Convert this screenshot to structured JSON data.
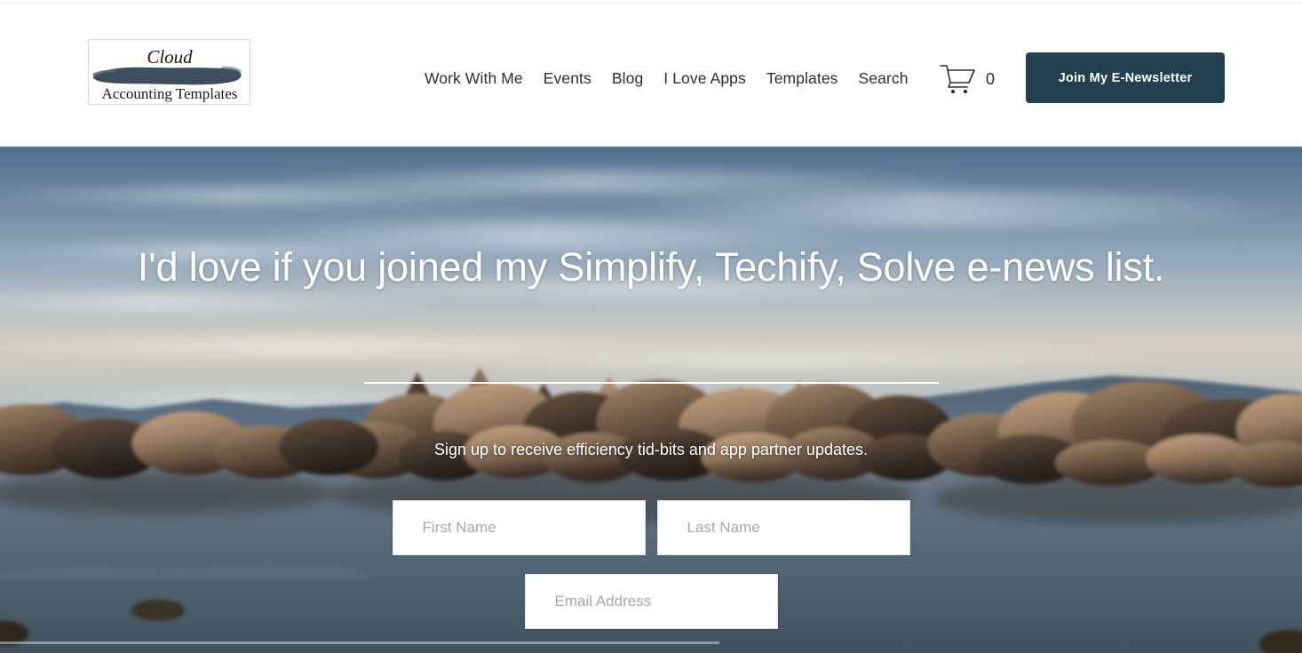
{
  "site": {
    "brand": {
      "name": "Cloud Accounting Templates",
      "script_word": "Cloud",
      "serif_words": "Accounting Templates",
      "brush_color": "#3d4e5e"
    },
    "theme": {
      "accent_dark": "#23404f",
      "header_bg": "#ffffff",
      "nav_text": "#2e2e2e",
      "hero_text": "#ffffff"
    }
  },
  "header": {
    "nav": [
      {
        "label": "Work With Me"
      },
      {
        "label": "Events"
      },
      {
        "label": "Blog"
      },
      {
        "label": "I Love Apps"
      },
      {
        "label": "Templates"
      },
      {
        "label": "Search"
      }
    ],
    "cart": {
      "icon": "shopping-cart-icon",
      "count": "0"
    },
    "cta": {
      "label": "Join My E-Newsletter"
    }
  },
  "hero": {
    "title": "I'd love if you joined my Simplify, Techify, Solve e-news list.",
    "subtitle": "Sign up to receive efficiency tid-bits and app partner updates.",
    "background": {
      "description": "Calm lake at dusk with granite boulders and distant mountains",
      "sky_top": "#5b7490",
      "sky_mid": "#9fb2c4",
      "sky_low": "#d8d2c4",
      "water": "#53626f",
      "rock_light": "#b99a7c",
      "rock_dark": "#3a2f28",
      "mountain": "#3e4c5e"
    }
  },
  "signup_form": {
    "fields": [
      {
        "name": "first-name",
        "placeholder": "First Name",
        "value": ""
      },
      {
        "name": "last-name",
        "placeholder": "Last Name",
        "value": ""
      },
      {
        "name": "email",
        "placeholder": "Email Address",
        "value": ""
      }
    ]
  }
}
